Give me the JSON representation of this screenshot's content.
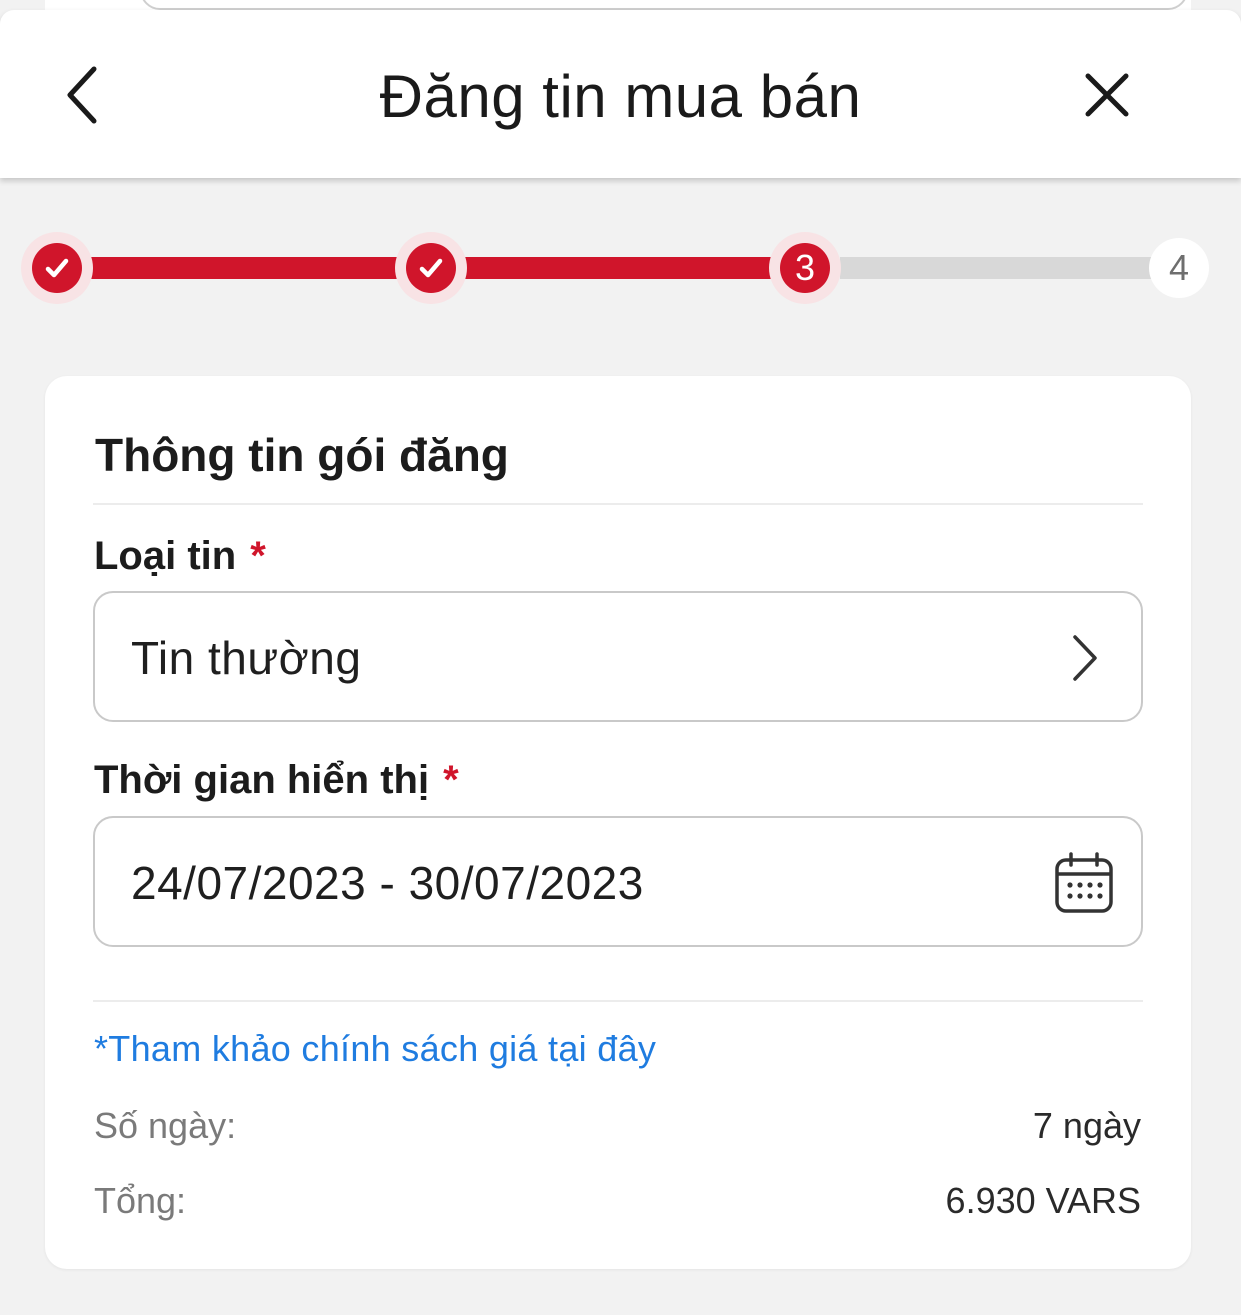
{
  "header": {
    "title": "Đăng tin mua bán",
    "back_icon": "chevron-left-icon",
    "close_icon": "close-icon"
  },
  "stepper": {
    "current_step": 3,
    "steps": [
      {
        "label": "",
        "state": "done"
      },
      {
        "label": "",
        "state": "done"
      },
      {
        "label": "3",
        "state": "active"
      },
      {
        "label": "4",
        "state": "pending"
      }
    ]
  },
  "card": {
    "title": "Thông tin gói đăng",
    "listing_type": {
      "label": "Loại tin",
      "required_mark": "*",
      "value": "Tin thường",
      "icon": "chevron-right-icon"
    },
    "display_period": {
      "label": "Thời gian hiển thị",
      "required_mark": "*",
      "value": "24/07/2023 - 30/07/2023",
      "icon": "calendar-icon"
    },
    "policy_link": "*Tham khảo chính sách giá tại đây",
    "summary": {
      "days_label": "Số ngày:",
      "days_value": "7 ngày",
      "total_label": "Tổng:",
      "total_value": "6.930 VARS"
    }
  },
  "colors": {
    "accent": "#d0152b",
    "link": "#1f7ce0",
    "background": "#f2f2f2"
  }
}
